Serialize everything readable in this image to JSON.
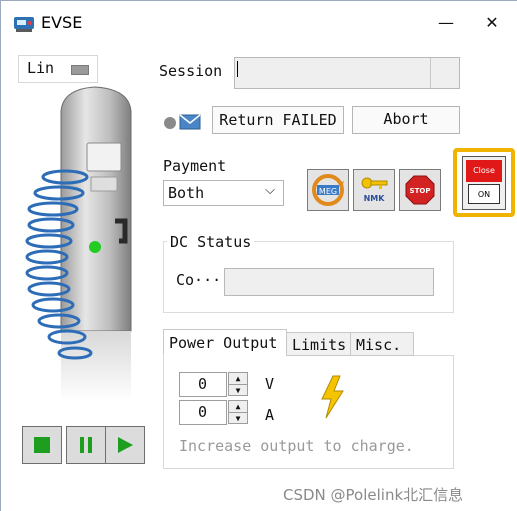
{
  "window": {
    "title": "EVSE",
    "minimize_glyph": "—",
    "close_glyph": "✕"
  },
  "left_panel": {
    "lin_label": "Lin",
    "playback": [
      "stop-icon",
      "pause-icon",
      "play-icon"
    ],
    "accent_green": "#1e9e1e"
  },
  "session": {
    "label": "Session",
    "value": ""
  },
  "actions": {
    "return_failed_label": "Return FAILED",
    "abort_label": "Abort"
  },
  "payment": {
    "label": "Payment",
    "selected": "Both",
    "icon_buttons": [
      {
        "icon": "meg-icon",
        "text": "MEG"
      },
      {
        "icon": "nmk-icon",
        "text": "NMK"
      },
      {
        "icon": "stop-sign-icon",
        "text": "STOP"
      }
    ],
    "close_toggle": {
      "top_text": "Close",
      "bottom_text": "ON",
      "highlight_color": "#f0b400"
    }
  },
  "dc_status": {
    "title": "DC Status",
    "row_label": "Co···",
    "value": ""
  },
  "tabs": {
    "items": [
      "Power Output",
      "Limits",
      "Misc."
    ],
    "active": "Power Output"
  },
  "power_output": {
    "voltage_value": "0",
    "voltage_unit": "V",
    "current_value": "0",
    "current_unit": "A",
    "hint": "Increase output to charge."
  },
  "watermark": "CSDN @Polelink北汇信息"
}
